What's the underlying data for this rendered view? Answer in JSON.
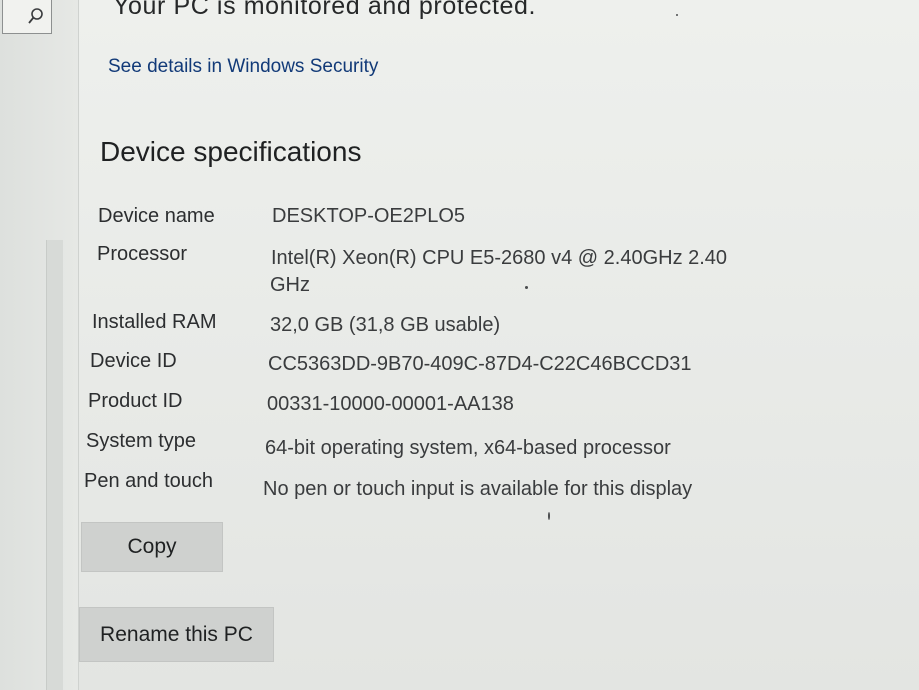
{
  "search": {
    "icon": "search-icon"
  },
  "protection": {
    "status_text": "Your PC is monitored and protected.",
    "details_link": "See details in Windows Security"
  },
  "device_specs": {
    "heading": "Device specifications",
    "rows": [
      {
        "label": "Device name",
        "value": "DESKTOP-OE2PLO5"
      },
      {
        "label": "Processor",
        "value": "Intel(R) Xeon(R) CPU E5-2680 v4 @ 2.40GHz   2.40",
        "value_line2": "GHz"
      },
      {
        "label": "Installed RAM",
        "value": "32,0 GB (31,8 GB usable)"
      },
      {
        "label": "Device ID",
        "value": "CC5363DD-9B70-409C-87D4-C22C46BCCD31"
      },
      {
        "label": "Product ID",
        "value": "00331-10000-00001-AA138"
      },
      {
        "label": "System type",
        "value": "64-bit operating system, x64-based processor"
      },
      {
        "label": "Pen and touch",
        "value": "No pen or touch input is available for this display"
      }
    ]
  },
  "buttons": {
    "copy_label": "Copy",
    "rename_label": "Rename this PC"
  }
}
